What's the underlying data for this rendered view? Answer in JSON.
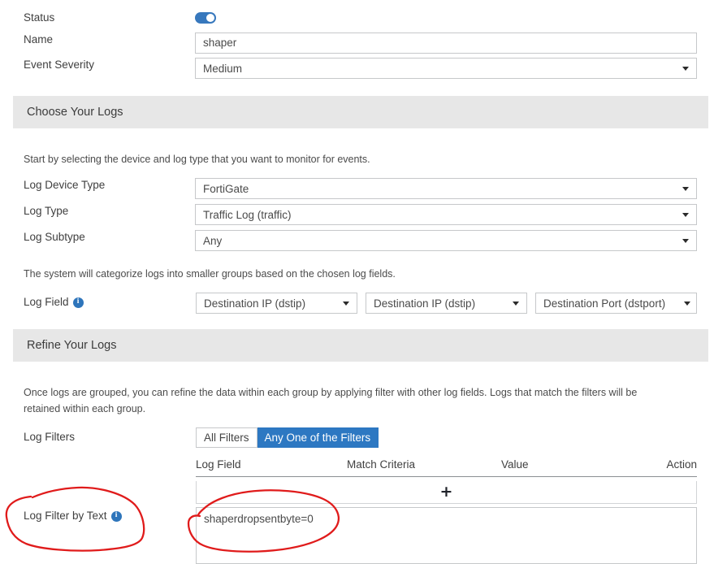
{
  "form": {
    "status": {
      "label": "Status",
      "enabled": true
    },
    "name": {
      "label": "Name",
      "value": "shaper"
    },
    "event_severity": {
      "label": "Event Severity",
      "value": "Medium"
    }
  },
  "choose_logs": {
    "section_title": "Choose Your Logs",
    "helper": "Start by selecting the device and log type that you want to monitor for events.",
    "log_device_type": {
      "label": "Log Device Type",
      "value": "FortiGate"
    },
    "log_type": {
      "label": "Log Type",
      "value": "Traffic Log (traffic)"
    },
    "log_subtype": {
      "label": "Log Subtype",
      "value": "Any"
    },
    "group_helper": "The system will categorize logs into smaller groups based on the chosen log fields.",
    "log_field": {
      "label": "Log Field",
      "info_icon": "info-icon",
      "values": [
        "Destination IP (dstip)",
        "Destination IP (dstip)",
        "Destination Port (dstport)"
      ]
    }
  },
  "refine_logs": {
    "section_title": "Refine Your Logs",
    "helper": "Once logs are grouped, you can refine the data within each group by applying filter with other log fields. Logs that match the filters will be retained within each group.",
    "log_filters": {
      "label": "Log Filters",
      "tabs": [
        {
          "label": "All Filters",
          "active": false
        },
        {
          "label": "Any One of the Filters",
          "active": true
        }
      ],
      "columns": [
        "Log Field",
        "Match Criteria",
        "Value",
        "Action"
      ],
      "add_button": "+"
    },
    "log_filter_by_text": {
      "label": "Log Filter by Text",
      "info_icon": "info-icon",
      "value": "shaperdropsentbyte=0",
      "misspelled": true
    }
  },
  "colors": {
    "accent_blue": "#2d78c2",
    "toggle_blue": "#3778bd",
    "section_gray": "#e7e7e7",
    "annotation_red": "#e01b1b",
    "border_gray": "#c6c8ca"
  }
}
